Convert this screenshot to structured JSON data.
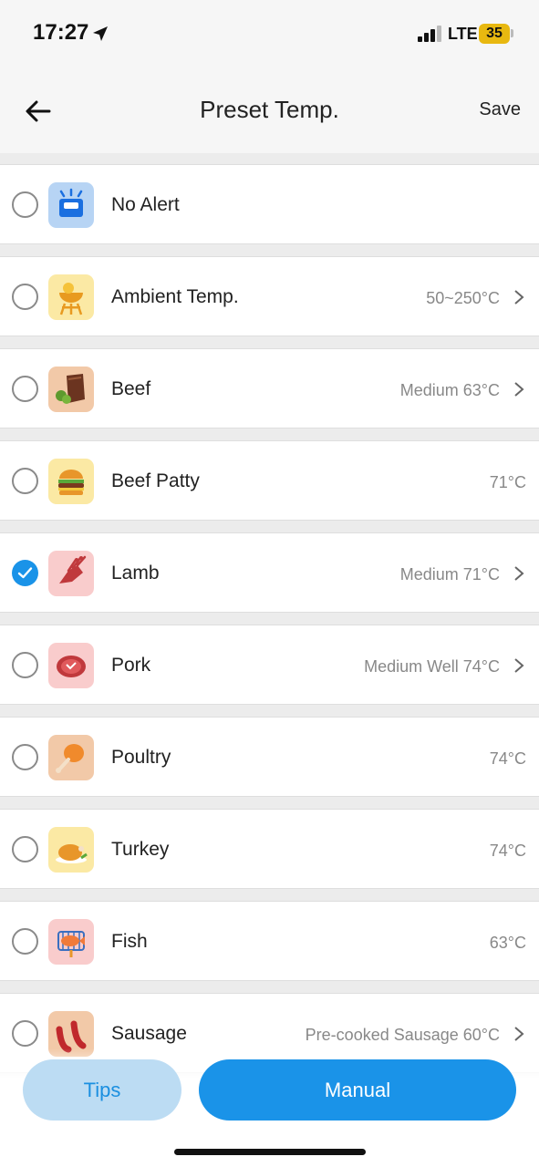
{
  "status": {
    "time": "17:27",
    "network": "LTE",
    "battery": "35",
    "icons": [
      "location-arrow-icon",
      "signal-icon",
      "battery-icon"
    ]
  },
  "header": {
    "title": "Preset Temp.",
    "save_label": "Save",
    "back_icon": "back-arrow-icon"
  },
  "items": [
    {
      "label": "No Alert",
      "value": "",
      "chevron": false,
      "selected": false,
      "icon": "no-alert-icon",
      "icon_bg": "#b7d4f4"
    },
    {
      "label": "Ambient Temp.",
      "value": "50~250°C",
      "chevron": true,
      "selected": false,
      "icon": "grill-icon",
      "icon_bg": "#fbe9a4"
    },
    {
      "label": "Beef",
      "value": "Medium 63°C",
      "chevron": true,
      "selected": false,
      "icon": "beef-icon",
      "icon_bg": "#f2c9a8"
    },
    {
      "label": "Beef Patty",
      "value": "71°C",
      "chevron": false,
      "selected": false,
      "icon": "burger-icon",
      "icon_bg": "#fbe9a4"
    },
    {
      "label": "Lamb",
      "value": "Medium 71°C",
      "chevron": true,
      "selected": true,
      "icon": "lamb-rack-icon",
      "icon_bg": "#f9cccc"
    },
    {
      "label": "Pork",
      "value": "Medium Well 74°C",
      "chevron": true,
      "selected": false,
      "icon": "pork-steak-icon",
      "icon_bg": "#f9cccc"
    },
    {
      "label": "Poultry",
      "value": "74°C",
      "chevron": false,
      "selected": false,
      "icon": "drumstick-icon",
      "icon_bg": "#f2c9a8"
    },
    {
      "label": "Turkey",
      "value": "74°C",
      "chevron": false,
      "selected": false,
      "icon": "roast-turkey-icon",
      "icon_bg": "#fbe9a4"
    },
    {
      "label": "Fish",
      "value": "63°C",
      "chevron": false,
      "selected": false,
      "icon": "grilled-fish-icon",
      "icon_bg": "#f9cccc"
    },
    {
      "label": "Sausage",
      "value": "Pre-cooked Sausage 60°C",
      "chevron": true,
      "selected": false,
      "icon": "sausage-icon",
      "icon_bg": "#f2c9a8"
    }
  ],
  "footer": {
    "tips_label": "Tips",
    "manual_label": "Manual"
  },
  "colors": {
    "accent": "#1a93e8",
    "tips_bg": "#bcdcf3",
    "battery": "#e8b810"
  }
}
